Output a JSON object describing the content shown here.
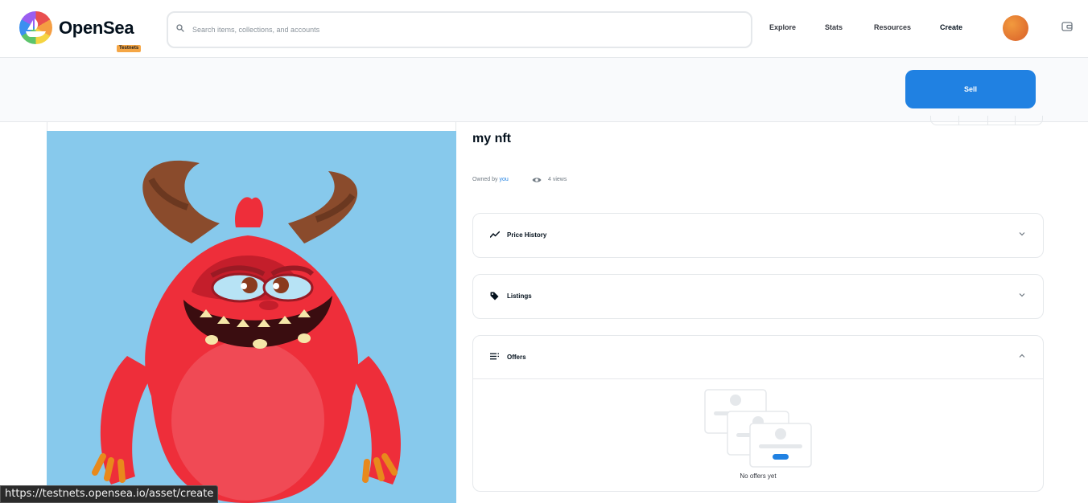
{
  "header": {
    "brand": "OpenSea",
    "badge": "Testnets",
    "search_placeholder": "Search items, collections, and accounts",
    "nav": {
      "explore": "Explore",
      "stats": "Stats",
      "resources": "Resources",
      "create": "Create"
    }
  },
  "sellbar": {
    "sell_label": "Sell"
  },
  "asset": {
    "title": "my nft",
    "owned_by_prefix": "Owned by ",
    "owner": "you",
    "views": "4 views"
  },
  "panels": {
    "price_history": "Price History",
    "listings": "Listings",
    "offers": "Offers",
    "offers_empty": "No offers yet"
  },
  "status_url": "https://testnets.opensea.io/asset/create",
  "colors": {
    "accent": "#2081e2",
    "badge": "#f5a645",
    "image_bg": "#87c9ec"
  }
}
